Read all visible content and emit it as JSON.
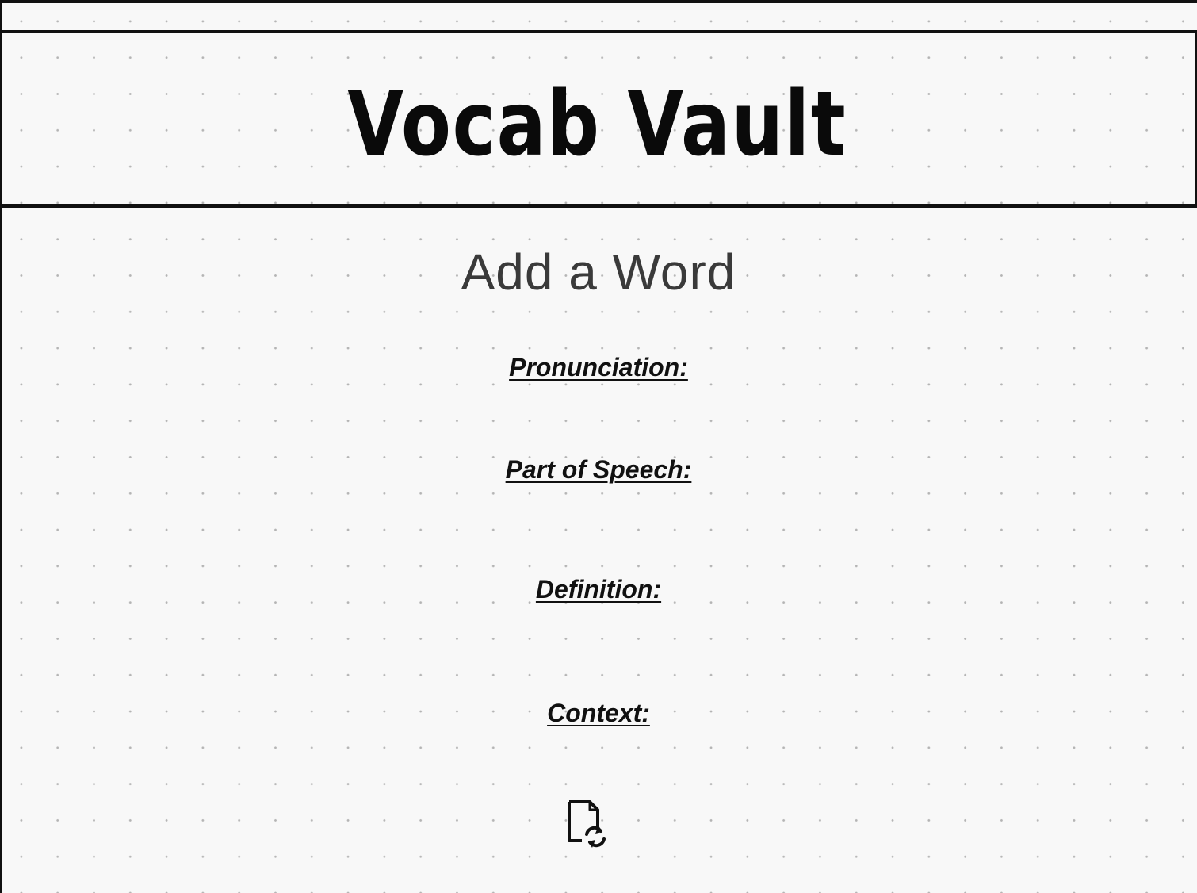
{
  "app": {
    "title": "Vocab Vault"
  },
  "form": {
    "heading": "Add a Word",
    "fields": {
      "pronunciation": "Pronunciation:",
      "part_of_speech": "Part of Speech:",
      "definition": "Definition:",
      "context": "Context:"
    },
    "refresh_icon": "file-refresh-icon"
  },
  "colors": {
    "background": "#f8f8f8",
    "dots": "#b4b4b4",
    "ink": "#111111",
    "heading_gray": "#3a3a3a"
  }
}
